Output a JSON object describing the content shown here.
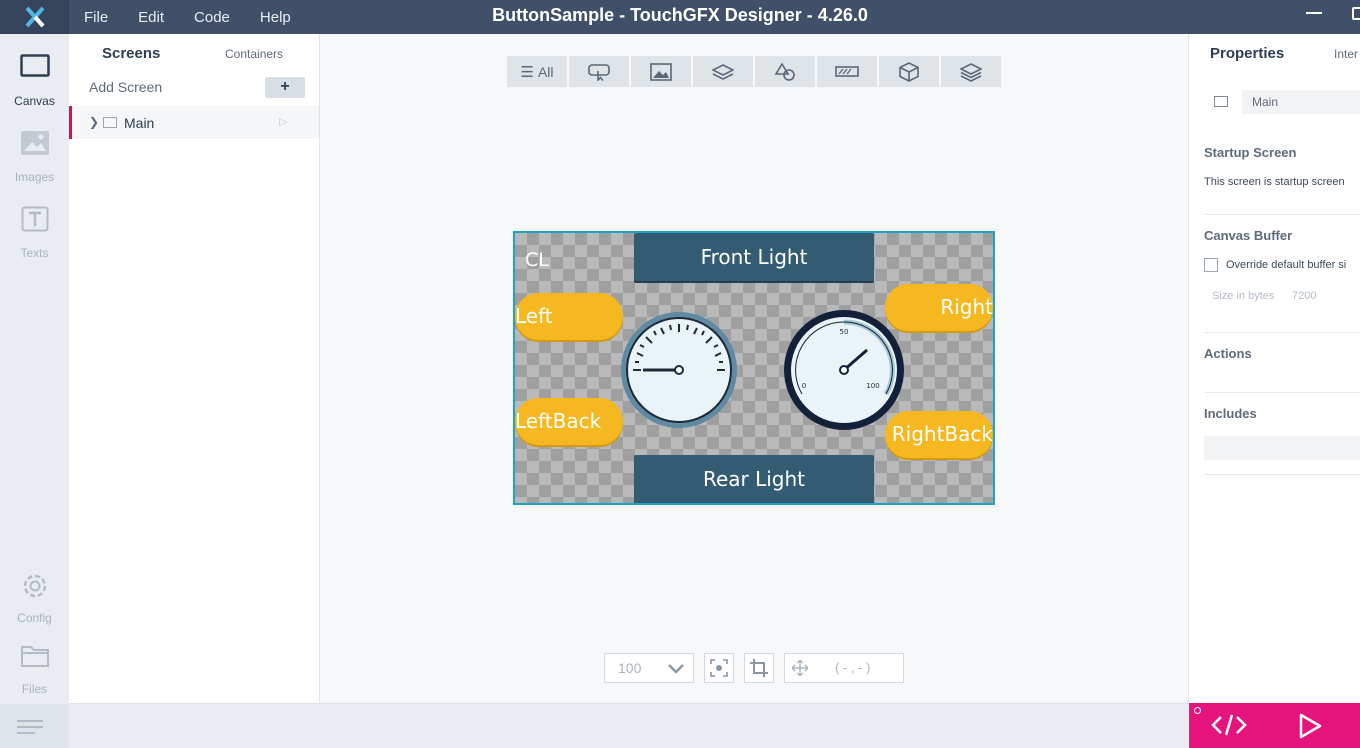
{
  "app": {
    "title": "ButtonSample - TouchGFX Designer - 4.26.0",
    "menu": [
      "File",
      "Edit",
      "Code",
      "Help"
    ]
  },
  "rail": {
    "items": [
      {
        "label": "Canvas",
        "icon": "canvas-icon",
        "active": true
      },
      {
        "label": "Images",
        "icon": "images-icon",
        "active": false
      },
      {
        "label": "Texts",
        "icon": "texts-icon",
        "active": false
      },
      {
        "label": "Config",
        "icon": "gear-icon",
        "active": false
      },
      {
        "label": "Files",
        "icon": "folder-icon",
        "active": false
      }
    ]
  },
  "screens_panel": {
    "tab_screens": "Screens",
    "tab_containers": "Containers",
    "add_screen": "Add Screen",
    "add_button": "+",
    "screens": [
      {
        "name": "Main"
      }
    ]
  },
  "canvas_toolbar": {
    "filters": [
      {
        "label": "All",
        "icon": "list-icon"
      },
      {
        "label": "",
        "icon": "interaction-icon"
      },
      {
        "label": "",
        "icon": "image-icon"
      },
      {
        "label": "",
        "icon": "layers-icon"
      },
      {
        "label": "",
        "icon": "shapes-icon"
      },
      {
        "label": "",
        "icon": "progress-icon"
      },
      {
        "label": "",
        "icon": "cube-icon"
      },
      {
        "label": "",
        "icon": "stack-icon"
      }
    ]
  },
  "design": {
    "corner_text": "CL",
    "front_light": "Front Light",
    "rear_light": "Rear Light",
    "left": "Left",
    "left_back": "LeftBack",
    "right": "Right",
    "right_back": "RightBack",
    "gauge_right_labels": {
      "min": "0",
      "mid": "50",
      "max": "100"
    },
    "colors": {
      "button_dark": "#335c73",
      "pill": "#f5b820",
      "selection": "#1ea3c8"
    }
  },
  "canvas_bottom": {
    "zoom": "100",
    "coords": "( - , - )"
  },
  "properties": {
    "tab_properties": "Properties",
    "tab_interactions": "Inter",
    "screen_name": "Main",
    "startup_title": "Startup Screen",
    "startup_text": "This screen is startup screen",
    "canvas_buffer_title": "Canvas Buffer",
    "override_label": "Override default buffer si",
    "size_label": "Size in bytes",
    "size_value": "7200",
    "actions_title": "Actions",
    "includes_title": "Includes"
  },
  "accent_color": "#e4147c"
}
